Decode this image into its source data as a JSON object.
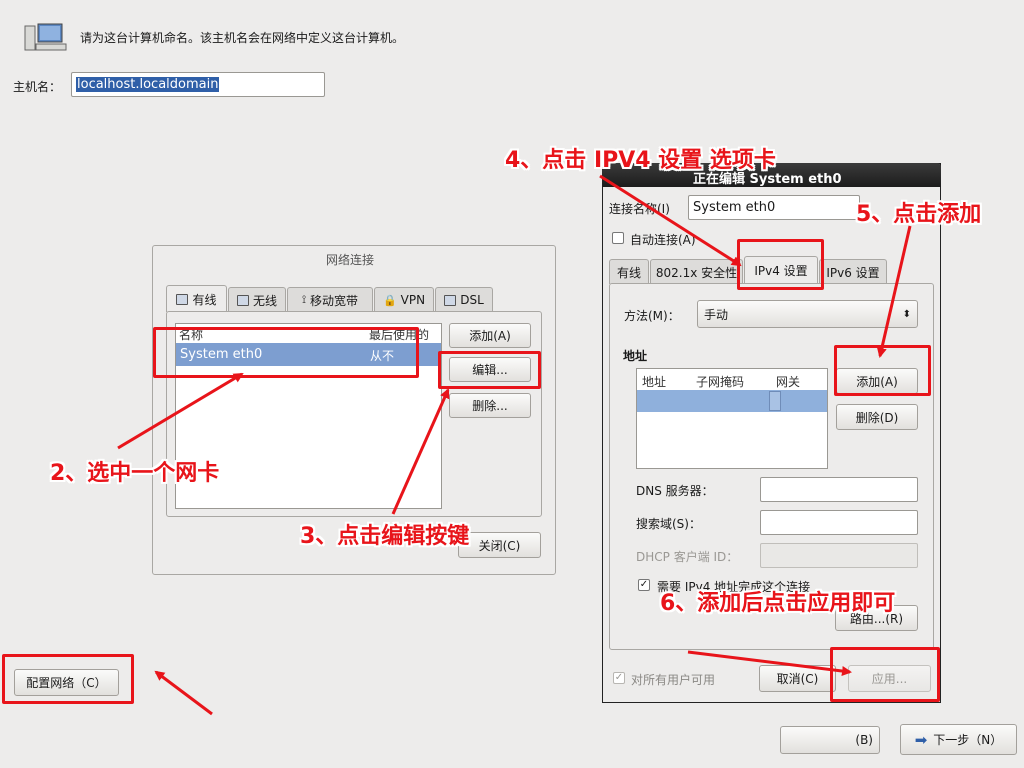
{
  "header": {
    "instruction": "请为这台计算机命名。该主机名会在网络中定义这台计算机。",
    "hostname_label": "主机名：",
    "hostname_value": "localhost.localdomain"
  },
  "configure_button": "配置网络（C）",
  "bottom_buttons": {
    "back": "(B)",
    "next": "下一步（N）"
  },
  "net_dialog": {
    "title": "网络连接",
    "tabs": [
      "有线",
      "无线",
      "移动宽带",
      "VPN",
      "DSL"
    ],
    "columns": [
      "名称",
      "最后使用的"
    ],
    "rows": [
      {
        "name": "System eth0",
        "last_used": "从不"
      }
    ],
    "add_button": "添加(A)",
    "edit_button": "编辑...",
    "delete_button": "删除...",
    "close_button": "关闭(C)"
  },
  "edit_dialog": {
    "title": "正在编辑 System eth0",
    "conn_name_label": "连接名称(I)",
    "conn_name_value": "System eth0",
    "auto_connect_label": "自动连接(A)",
    "tabs": [
      "有线",
      "802.1x 安全性",
      "IPv4 设置",
      "IPv6 设置"
    ],
    "method_label": "方法(M)：",
    "method_value": "手动",
    "address_label": "地址",
    "address_columns": [
      "地址",
      "子网掩码",
      "网关"
    ],
    "add_button": "添加(A)",
    "delete_button": "删除(D)",
    "dns_label": "DNS 服务器：",
    "search_label": "搜索域(S)：",
    "dhcp_label": "DHCP 客户端 ID：",
    "require_ipv4_label": "需要 IPv4 地址完成这个连接",
    "routes_button": "路由...(R)",
    "all_users_label": "对所有用户可用",
    "cancel_button": "取消(C)",
    "apply_button": "应用..."
  },
  "annotations": {
    "step2": "2、选中一个网卡",
    "step3": "3、点击编辑按键",
    "step4": "4、点击 IPV4 设置 选项卡",
    "step5": "5、点击添加",
    "step6": "6、添加后点击应用即可"
  },
  "colors": {
    "annotation_red": "#e8141a",
    "selection_blue": "#7d9ed0",
    "background": "#edeceb"
  }
}
